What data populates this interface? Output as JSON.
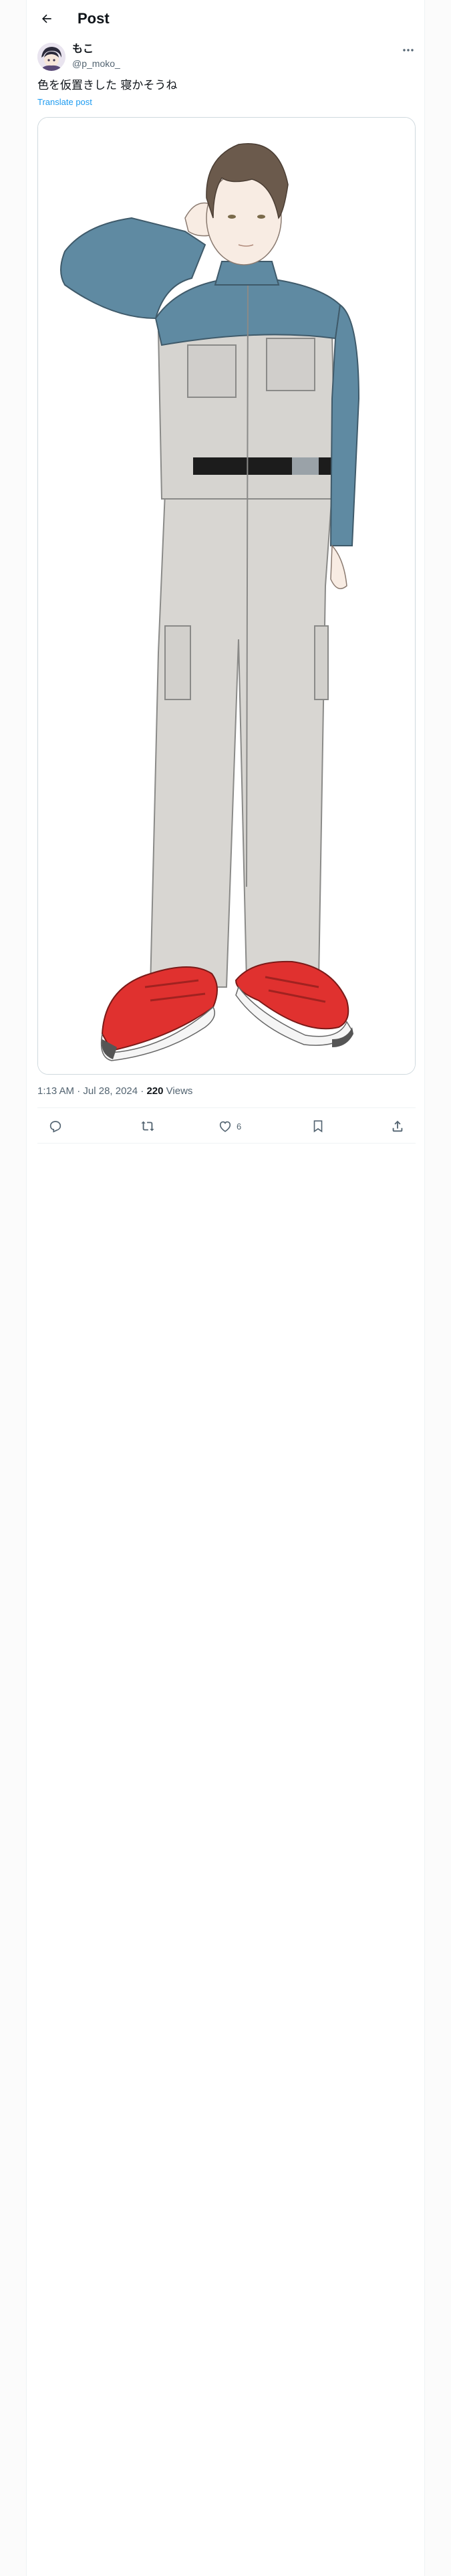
{
  "header": {
    "title": "Post",
    "back_icon": "arrow-left-icon"
  },
  "author": {
    "name": "もこ",
    "handle": "@p_moko_",
    "avatar_icon": "avatar-image"
  },
  "post": {
    "text": "色を仮置きした 寝かそうね",
    "translate_label": "Translate post",
    "media_icon": "illustration-man-in-work-jumpsuit"
  },
  "meta": {
    "time": "1:13 AM",
    "sep1": " · ",
    "date": "Jul 28, 2024",
    "sep2": " · ",
    "views_count": "220",
    "views_label": " Views"
  },
  "actions": {
    "like_count": "6"
  },
  "colors": {
    "accent": "#1d9bf0",
    "text": "#0f1419",
    "muted": "#536471",
    "border": "#eff3f4"
  }
}
